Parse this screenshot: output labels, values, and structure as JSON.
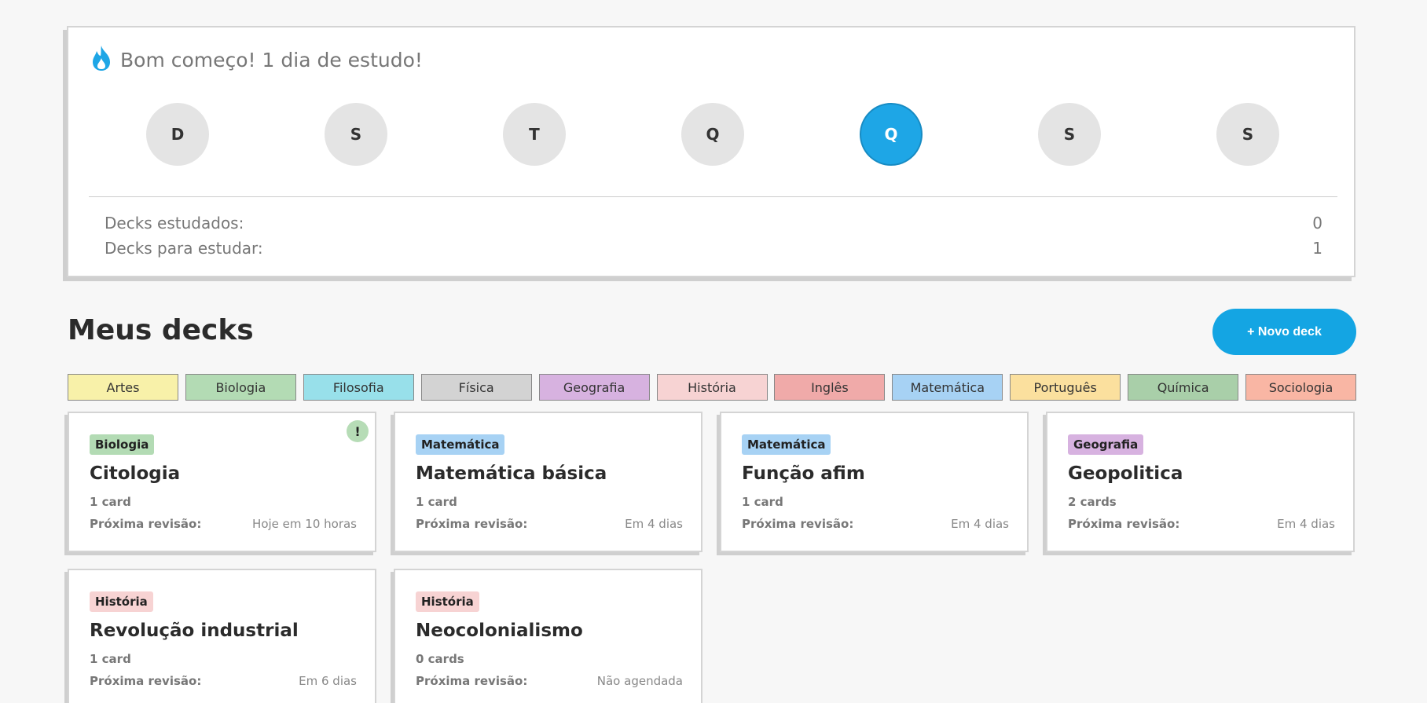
{
  "streak": {
    "icon": "flame-icon",
    "title": "Bom começo! 1 dia de estudo!",
    "days": [
      "D",
      "S",
      "T",
      "Q",
      "Q",
      "S",
      "S"
    ],
    "active_day_index": 4,
    "stats": [
      {
        "label": "Decks estudados:",
        "value": "0"
      },
      {
        "label": "Decks para estudar:",
        "value": "1"
      }
    ]
  },
  "decks_section": {
    "title": "Meus decks",
    "new_deck_label": "+ Novo deck"
  },
  "tags": [
    {
      "label": "Artes",
      "color": "#f8f1a9"
    },
    {
      "label": "Biologia",
      "color": "#b3dbb4"
    },
    {
      "label": "Filosofia",
      "color": "#98e0ea"
    },
    {
      "label": "Física",
      "color": "#d3d3d3"
    },
    {
      "label": "Geografia",
      "color": "#d7b2e0"
    },
    {
      "label": "História",
      "color": "#f7d3d3"
    },
    {
      "label": "Inglês",
      "color": "#f0aaa9"
    },
    {
      "label": "Matemática",
      "color": "#a7d2f4"
    },
    {
      "label": "Português",
      "color": "#fbe09e"
    },
    {
      "label": "Química",
      "color": "#a9cfa9"
    },
    {
      "label": "Sociologia",
      "color": "#f9b6a4"
    }
  ],
  "decks": [
    {
      "tag": "Biologia",
      "tag_color": "#b3dbb4",
      "name": "Citologia",
      "count": "1 card",
      "review_label": "Próxima revisão:",
      "review_value": "Hoje em 10 horas",
      "alert": "!"
    },
    {
      "tag": "Matemática",
      "tag_color": "#a7d2f4",
      "name": "Matemática básica",
      "count": "1 card",
      "review_label": "Próxima revisão:",
      "review_value": "Em 4 dias"
    },
    {
      "tag": "Matemática",
      "tag_color": "#a7d2f4",
      "name": "Função afim",
      "count": "1 card",
      "review_label": "Próxima revisão:",
      "review_value": "Em 4 dias"
    },
    {
      "tag": "Geografia",
      "tag_color": "#d7b2e0",
      "name": "Geopolitica",
      "count": "2 cards",
      "review_label": "Próxima revisão:",
      "review_value": "Em 4 dias"
    },
    {
      "tag": "História",
      "tag_color": "#f7d3d3",
      "name": "Revolução industrial",
      "count": "1 card",
      "review_label": "Próxima revisão:",
      "review_value": "Em 6 dias"
    },
    {
      "tag": "História",
      "tag_color": "#f7d3d3",
      "name": "Neocolonialismo",
      "count": "0 cards",
      "review_label": "Próxima revisão:",
      "review_value": "Não agendada"
    }
  ],
  "colors": {
    "accent": "#14a5e3",
    "flame": "#1ea6e6"
  }
}
